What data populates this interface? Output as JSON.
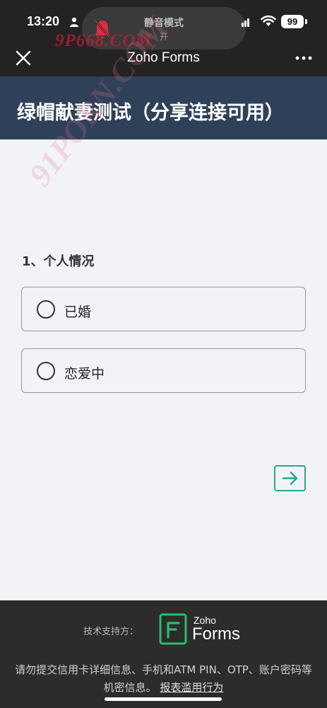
{
  "status_bar": {
    "time": "13:20",
    "battery": "99"
  },
  "notification": {
    "title": "静音模式",
    "subtitle": "开"
  },
  "watermarks": {
    "top": "9P668.COM",
    "diagonal": "91PORN.COM"
  },
  "nav": {
    "title": "Zoho Forms"
  },
  "form": {
    "title": "绿帽献妻测试（分享连接可用）",
    "question": "1、个人情况",
    "options": [
      {
        "label": "已婚"
      },
      {
        "label": "恋爱中"
      }
    ]
  },
  "footer": {
    "powered_by": "技术支持方：",
    "logo_zoho": "Zoho",
    "logo_forms": "Forms",
    "disclaimer": "请勿提交信用卡详细信息、手机和ATM PIN、OTP、账户密码等机密信息。",
    "report_link": "报表滥用行为"
  },
  "colors": {
    "header_bg": "#2f4059",
    "accent": "#25a98f",
    "footer_bg": "#2c2c2c"
  }
}
